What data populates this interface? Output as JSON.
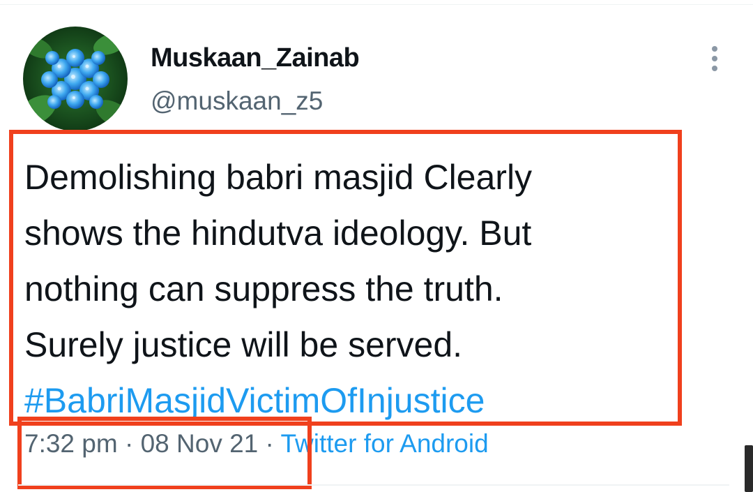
{
  "tweet": {
    "author": {
      "display_name": "Muskaan_Zainab",
      "handle": "@muskaan_z5",
      "avatar_icon": "hydrangea-flower-avatar"
    },
    "text_lines": [
      "Demolishing babri masjid Clearly",
      "shows the hindutva ideology. But",
      "nothing can suppress the truth.",
      "Surely justice will be served."
    ],
    "hashtag": "#BabriMasjidVictimOfInjustice",
    "time": "7:32 pm",
    "date": "08 Nov 21",
    "separator": "·",
    "source": "Twitter for Android",
    "more_icon": "more-vertical-icon"
  },
  "colors": {
    "text_primary": "#0f1419",
    "text_secondary": "#536471",
    "link": "#1d9bf0",
    "annotation_box": "#f0401d"
  }
}
